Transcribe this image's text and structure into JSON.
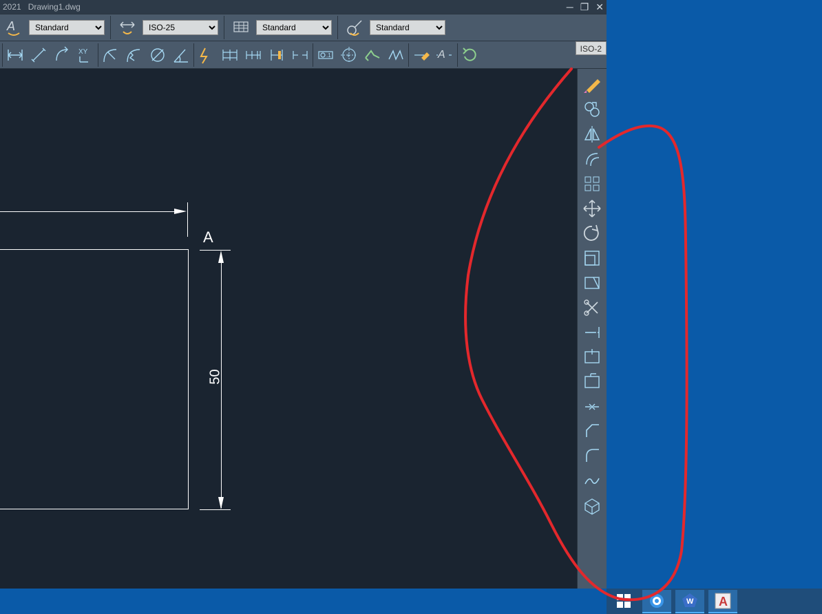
{
  "titlebar": {
    "year": "2021",
    "document": "Drawing1.dwg"
  },
  "style_bar": {
    "text_style": "Standard",
    "dim_style": "ISO-25",
    "table_style": "Standard",
    "multileader_style": "Standard"
  },
  "ribbon": {
    "iso_label": "ISO-2"
  },
  "drawing": {
    "label_A": "A",
    "dim_value": "50"
  },
  "taskbar": {
    "app_letter": "A"
  }
}
